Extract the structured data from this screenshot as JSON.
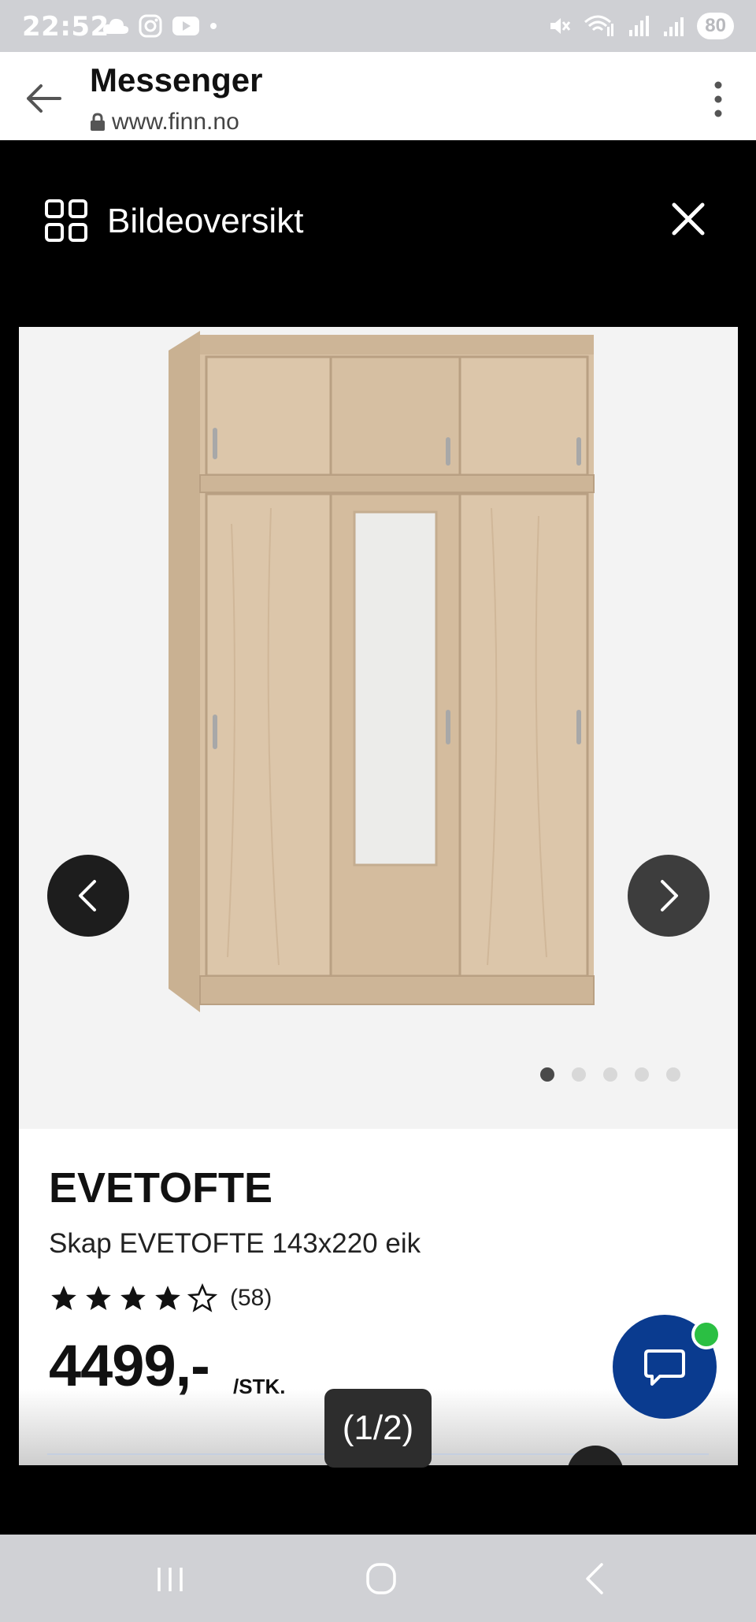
{
  "status_bar": {
    "time": "22:52",
    "battery": "80",
    "left_icons": [
      "cloud-icon",
      "instagram-icon",
      "youtube-icon",
      "dot-icon"
    ],
    "right_icons": [
      "mute-icon",
      "wifi-icon",
      "signal-icon",
      "signal-icon-2"
    ]
  },
  "browser": {
    "title": "Messenger",
    "url": "www.finn.no"
  },
  "viewer": {
    "title": "Bildeoversikt",
    "counter": "(1/2)",
    "dots_total": 5,
    "dots_active": 1
  },
  "product": {
    "name": "EVETOFTE",
    "description": "Skap EVETOFTE 143x220 eik",
    "rating": 4,
    "rating_max": 5,
    "review_count": "(58)",
    "price": "4499,-",
    "unit": "/STK."
  },
  "colors": {
    "chat_fab": "#0a3b8f",
    "chat_badge": "#2bbf43",
    "wood": "#d8c1a4"
  }
}
